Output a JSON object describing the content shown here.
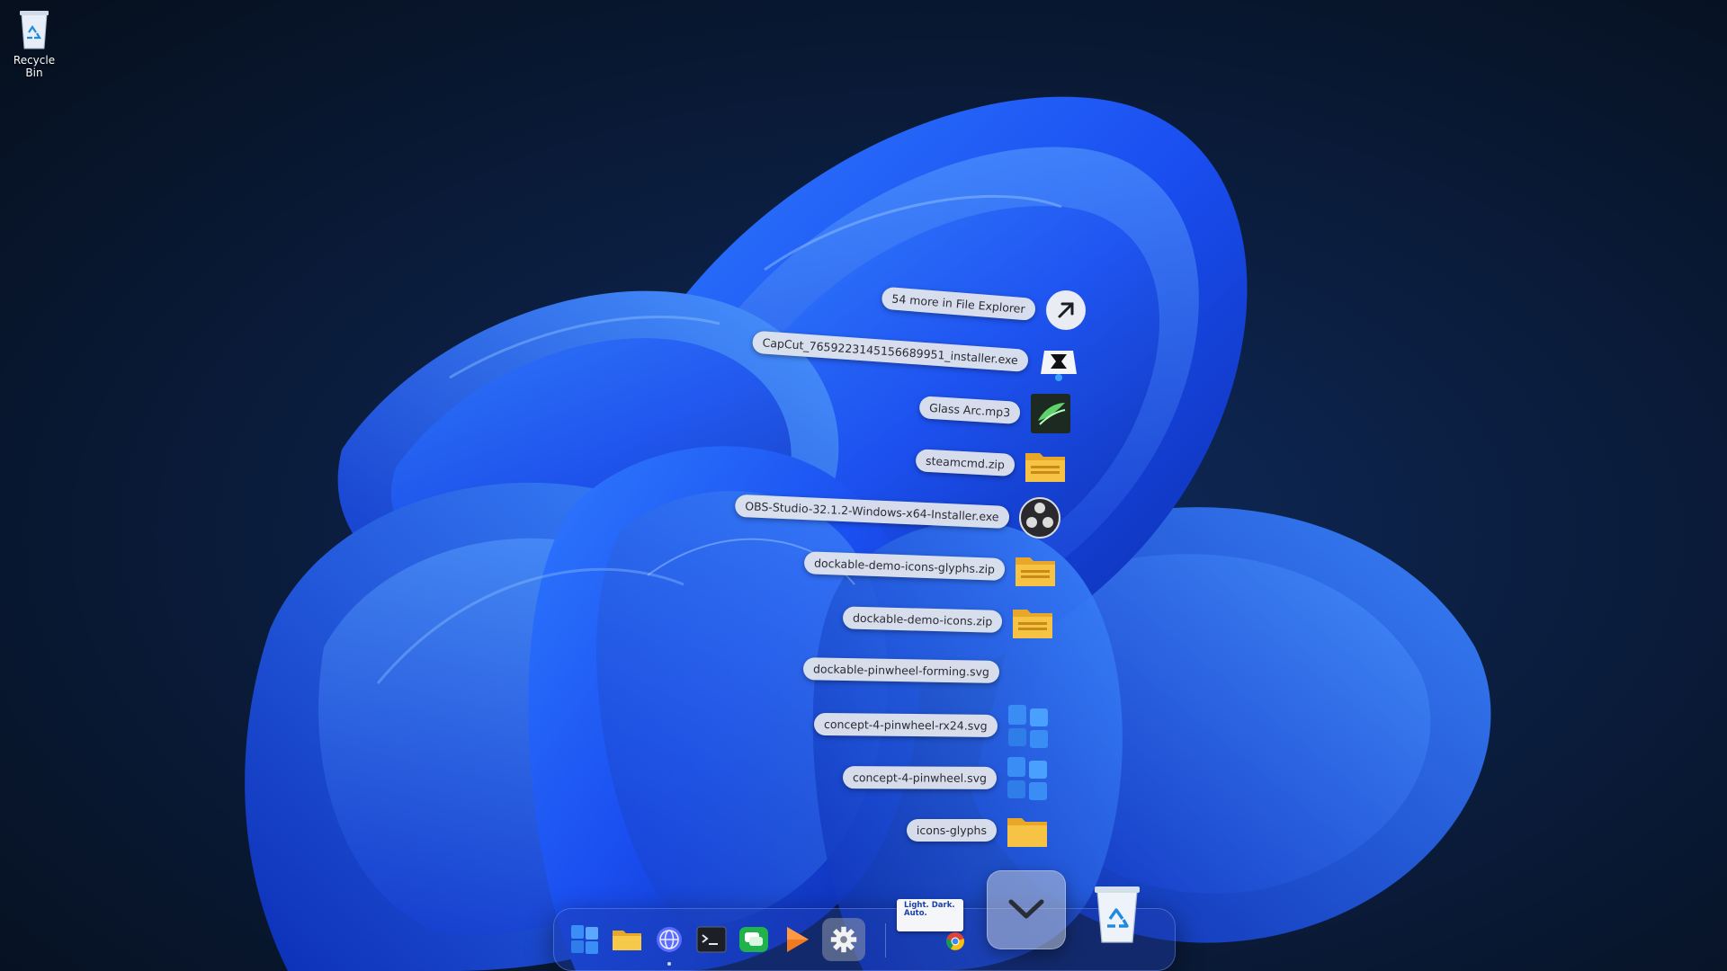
{
  "desktop": {
    "recycle_bin_label": "Recycle Bin"
  },
  "stack": {
    "items": [
      {
        "label": "54 more in File Explorer",
        "icon": "arrow-up-right-icon",
        "angle": 4.5
      },
      {
        "label": "CapCut_7659223145156689951_installer.exe",
        "icon": "capcut-installer-icon",
        "angle": 4.0
      },
      {
        "label": "Glass Arc.mp3",
        "icon": "audio-file-icon",
        "angle": 3.5
      },
      {
        "label": "steamcmd.zip",
        "icon": "zip-folder-icon",
        "angle": 3.0
      },
      {
        "label": "OBS-Studio-32.1.2-Windows-x64-Installer.exe",
        "icon": "obs-studio-icon",
        "angle": 2.5
      },
      {
        "label": "dockable-demo-icons-glyphs.zip",
        "icon": "zip-folder-icon",
        "angle": 2.0
      },
      {
        "label": "dockable-demo-icons.zip",
        "icon": "zip-folder-icon",
        "angle": 1.5
      },
      {
        "label": "dockable-pinwheel-forming.svg",
        "icon": "svg-file-icon",
        "angle": 1.0
      },
      {
        "label": "concept-4-pinwheel-rx24.svg",
        "icon": "pinwheel-icon",
        "angle": 0.6
      },
      {
        "label": "concept-4-pinwheel.svg",
        "icon": "pinwheel-icon",
        "angle": 0.3
      },
      {
        "label": "icons-glyphs",
        "icon": "folder-icon",
        "angle": 0
      }
    ]
  },
  "dock": {
    "thumbnail_text": "Light. Dark. Auto.",
    "items": [
      "windows-start-icon",
      "file-explorer-icon",
      "browser-globe-icon",
      "terminal-icon",
      "chat-icon",
      "media-player-icon",
      "settings-gear-icon"
    ]
  },
  "colors": {
    "accent": "#1e5bff",
    "pill": "#e2e5ec",
    "folder": "#f6c344"
  }
}
